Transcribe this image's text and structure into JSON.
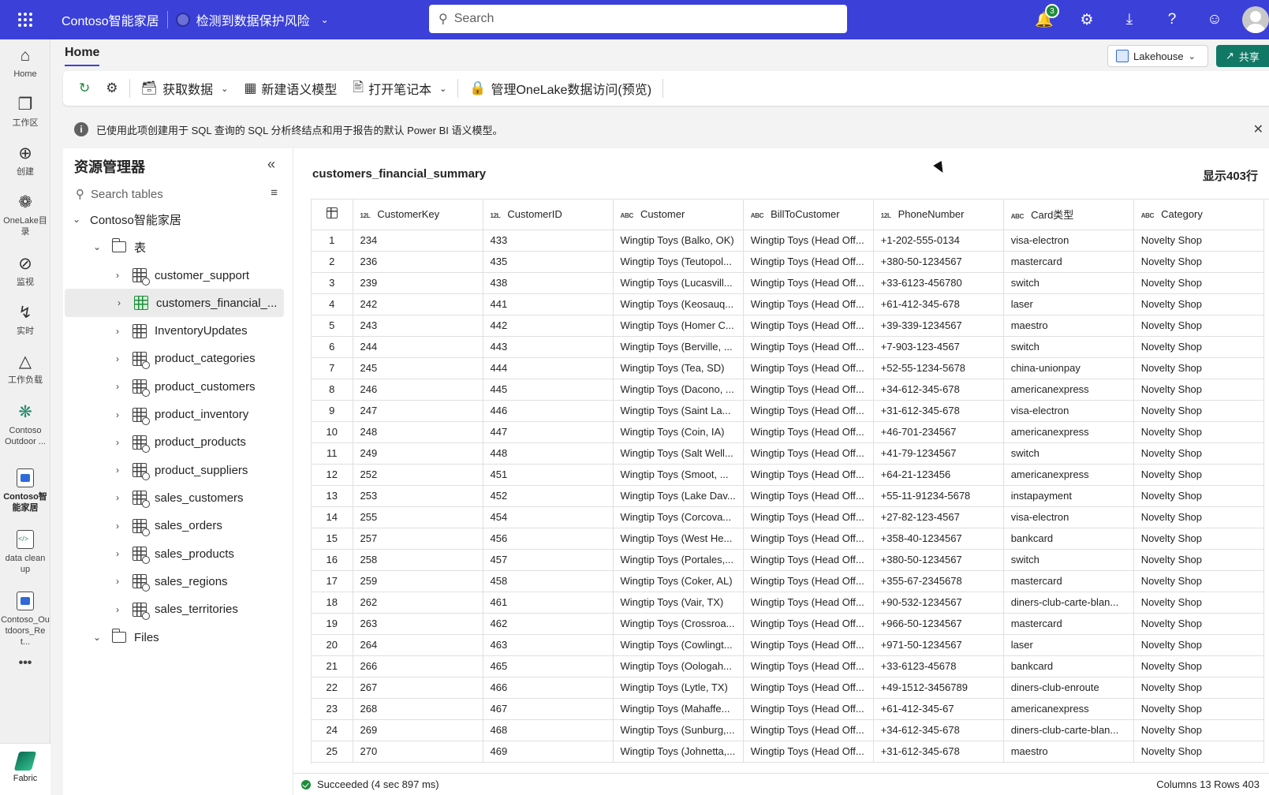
{
  "topbar": {
    "app_title": "Contoso智能家居",
    "risk_label": "检测到数据保护风险",
    "search_placeholder": "Search",
    "notification_count": "3"
  },
  "leftnav": {
    "items": [
      {
        "label": "Home",
        "icon": "home-icon"
      },
      {
        "label": "工作区",
        "icon": "workspaces-icon"
      },
      {
        "label": "创建",
        "icon": "create-icon"
      },
      {
        "label": "OneLake目录",
        "icon": "onelake-icon"
      },
      {
        "label": "监视",
        "icon": "monitor-icon"
      },
      {
        "label": "实时",
        "icon": "realtime-icon"
      },
      {
        "label": "工作负载",
        "icon": "workloads-icon"
      },
      {
        "label": "Contoso Outdoor ...",
        "icon": "workspace-icon"
      },
      {
        "label": "Contoso智能家居",
        "icon": "lakehouse-icon"
      },
      {
        "label": "data clean up",
        "icon": "notebook-icon"
      },
      {
        "label": "Contoso_Outdoors_Ret...",
        "icon": "lakehouse-icon"
      }
    ],
    "more": "•••",
    "fabric_label": "Fabric"
  },
  "header": {
    "tab": "Home",
    "lakehouse_label": "Lakehouse",
    "share_label": "共享"
  },
  "ribbon": {
    "get_data": "获取数据",
    "new_semantic_model": "新建语义模型",
    "open_notebook": "打开笔记本",
    "manage_onelake": "管理OneLake数据访问(预览)"
  },
  "info_message": "已使用此项创建用于 SQL 查询的 SQL 分析终结点和用于报告的默认 Power BI 语义模型。",
  "explorer": {
    "title": "资源管理器",
    "search_placeholder": "Search tables",
    "root": "Contoso智能家居",
    "tables_folder": "表",
    "tables": [
      "customer_support",
      "customers_financial_...",
      "InventoryUpdates",
      "product_categories",
      "product_customers",
      "product_inventory",
      "product_products",
      "product_suppliers",
      "sales_customers",
      "sales_orders",
      "sales_products",
      "sales_regions",
      "sales_territories"
    ],
    "files_folder": "Files"
  },
  "preview": {
    "table_name": "customers_financial_summary",
    "row_count_label": "显示403行",
    "columns": [
      {
        "type": "12L",
        "name": "CustomerKey"
      },
      {
        "type": "12L",
        "name": "CustomerID"
      },
      {
        "type": "ABC",
        "name": "Customer"
      },
      {
        "type": "ABC",
        "name": "BillToCustomer"
      },
      {
        "type": "12L",
        "name": "PhoneNumber"
      },
      {
        "type": "ABC",
        "name": "Card类型"
      },
      {
        "type": "ABC",
        "name": "Category"
      }
    ],
    "rows": [
      [
        "1",
        "234",
        "433",
        "Wingtip Toys (Balko, OK)",
        "Wingtip Toys (Head Off...",
        "+1-202-555-0134",
        "visa-electron",
        "Novelty Shop"
      ],
      [
        "2",
        "236",
        "435",
        "Wingtip Toys (Teutopol...",
        "Wingtip Toys (Head Off...",
        "+380-50-1234567",
        "mastercard",
        "Novelty Shop"
      ],
      [
        "3",
        "239",
        "438",
        "Wingtip Toys (Lucasvill...",
        "Wingtip Toys (Head Off...",
        "+33-6123-456780",
        "switch",
        "Novelty Shop"
      ],
      [
        "4",
        "242",
        "441",
        "Wingtip Toys (Keosauq...",
        "Wingtip Toys (Head Off...",
        "+61-412-345-678",
        "laser",
        "Novelty Shop"
      ],
      [
        "5",
        "243",
        "442",
        "Wingtip Toys (Homer C...",
        "Wingtip Toys (Head Off...",
        "+39-339-1234567",
        "maestro",
        "Novelty Shop"
      ],
      [
        "6",
        "244",
        "443",
        "Wingtip Toys (Berville, ...",
        "Wingtip Toys (Head Off...",
        "+7-903-123-4567",
        "switch",
        "Novelty Shop"
      ],
      [
        "7",
        "245",
        "444",
        "Wingtip Toys (Tea, SD)",
        "Wingtip Toys (Head Off...",
        "+52-55-1234-5678",
        "china-unionpay",
        "Novelty Shop"
      ],
      [
        "8",
        "246",
        "445",
        "Wingtip Toys (Dacono, ...",
        "Wingtip Toys (Head Off...",
        "+34-612-345-678",
        "americanexpress",
        "Novelty Shop"
      ],
      [
        "9",
        "247",
        "446",
        "Wingtip Toys (Saint La...",
        "Wingtip Toys (Head Off...",
        "+31-612-345-678",
        "visa-electron",
        "Novelty Shop"
      ],
      [
        "10",
        "248",
        "447",
        "Wingtip Toys (Coin, IA)",
        "Wingtip Toys (Head Off...",
        "+46-701-234567",
        "americanexpress",
        "Novelty Shop"
      ],
      [
        "11",
        "249",
        "448",
        "Wingtip Toys (Salt Well...",
        "Wingtip Toys (Head Off...",
        "+41-79-1234567",
        "switch",
        "Novelty Shop"
      ],
      [
        "12",
        "252",
        "451",
        "Wingtip Toys (Smoot, ...",
        "Wingtip Toys (Head Off...",
        "+64-21-123456",
        "americanexpress",
        "Novelty Shop"
      ],
      [
        "13",
        "253",
        "452",
        "Wingtip Toys (Lake Dav...",
        "Wingtip Toys (Head Off...",
        "+55-11-91234-5678",
        "instapayment",
        "Novelty Shop"
      ],
      [
        "14",
        "255",
        "454",
        "Wingtip Toys (Corcova...",
        "Wingtip Toys (Head Off...",
        "+27-82-123-4567",
        "visa-electron",
        "Novelty Shop"
      ],
      [
        "15",
        "257",
        "456",
        "Wingtip Toys (West He...",
        "Wingtip Toys (Head Off...",
        "+358-40-1234567",
        "bankcard",
        "Novelty Shop"
      ],
      [
        "16",
        "258",
        "457",
        "Wingtip Toys (Portales,...",
        "Wingtip Toys (Head Off...",
        "+380-50-1234567",
        "switch",
        "Novelty Shop"
      ],
      [
        "17",
        "259",
        "458",
        "Wingtip Toys (Coker, AL)",
        "Wingtip Toys (Head Off...",
        "+355-67-2345678",
        "mastercard",
        "Novelty Shop"
      ],
      [
        "18",
        "262",
        "461",
        "Wingtip Toys (Vair, TX)",
        "Wingtip Toys (Head Off...",
        "+90-532-1234567",
        "diners-club-carte-blan...",
        "Novelty Shop"
      ],
      [
        "19",
        "263",
        "462",
        "Wingtip Toys (Crossroa...",
        "Wingtip Toys (Head Off...",
        "+966-50-1234567",
        "mastercard",
        "Novelty Shop"
      ],
      [
        "20",
        "264",
        "463",
        "Wingtip Toys (Cowlingt...",
        "Wingtip Toys (Head Off...",
        "+971-50-1234567",
        "laser",
        "Novelty Shop"
      ],
      [
        "21",
        "266",
        "465",
        "Wingtip Toys (Oologah...",
        "Wingtip Toys (Head Off...",
        "+33-6123-45678",
        "bankcard",
        "Novelty Shop"
      ],
      [
        "22",
        "267",
        "466",
        "Wingtip Toys (Lytle, TX)",
        "Wingtip Toys (Head Off...",
        "+49-1512-3456789",
        "diners-club-enroute",
        "Novelty Shop"
      ],
      [
        "23",
        "268",
        "467",
        "Wingtip Toys (Mahaffe...",
        "Wingtip Toys (Head Off...",
        "+61-412-345-67",
        "americanexpress",
        "Novelty Shop"
      ],
      [
        "24",
        "269",
        "468",
        "Wingtip Toys (Sunburg,...",
        "Wingtip Toys (Head Off...",
        "+34-612-345-678",
        "diners-club-carte-blan...",
        "Novelty Shop"
      ],
      [
        "25",
        "270",
        "469",
        "Wingtip Toys (Johnetta,...",
        "Wingtip Toys (Head Off...",
        "+31-612-345-678",
        "maestro",
        "Novelty Shop"
      ]
    ]
  },
  "status": {
    "message": "Succeeded (4 sec 897 ms)",
    "summary": "Columns 13 Rows 403"
  },
  "colors": {
    "topbar": "#3b40d8",
    "share_button": "#117865",
    "success": "#1e8c3a"
  }
}
